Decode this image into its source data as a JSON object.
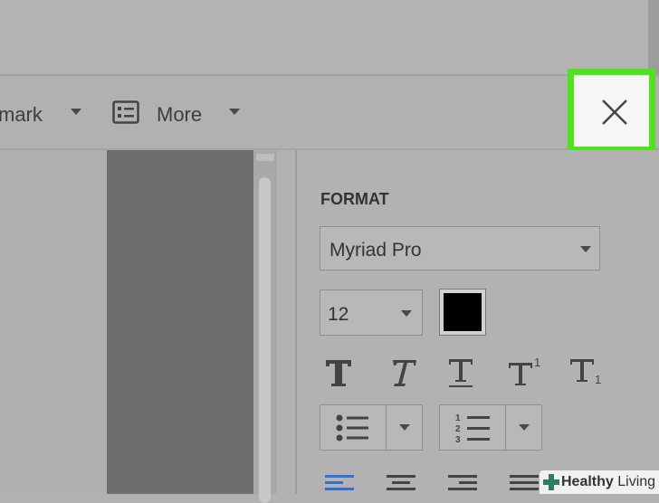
{
  "toolbar": {
    "bookmark_label": "mark",
    "more_label": "More"
  },
  "format_panel": {
    "title": "FORMAT",
    "font": "Myriad Pro",
    "font_size": "12",
    "text_color": "#000000",
    "style_buttons": [
      "bold-t-icon",
      "italic-t-icon",
      "underline-t-icon",
      "superscript-icon",
      "subscript-icon"
    ],
    "list_buttons": [
      "bulleted-list-icon",
      "numbered-list-icon"
    ],
    "numbered_list_digits": [
      "1",
      "2",
      "3"
    ],
    "superscript_digit": "1",
    "subscript_digit": "1",
    "alignment_buttons": [
      "align-left-icon",
      "align-center-icon",
      "align-right-icon",
      "justify-icon"
    ]
  },
  "watermark": {
    "brand_bold": "Healthy",
    "brand_rest": " Living"
  },
  "colors": {
    "highlight": "#50e31d",
    "accent_blue": "#2f6fd6"
  }
}
